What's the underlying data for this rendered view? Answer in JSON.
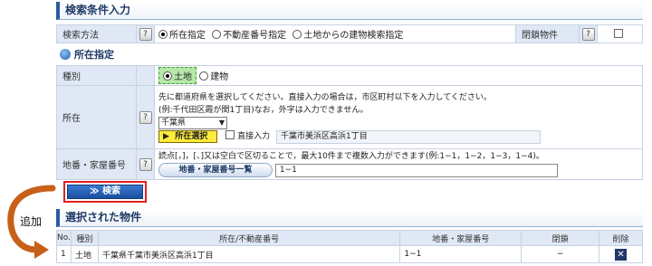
{
  "search_conditions": {
    "title": "検索条件入力",
    "method_label": "検索方法",
    "method_options": [
      "所在指定",
      "不動産番号指定",
      "土地からの建物検索指定"
    ],
    "closed_label": "閉鎖物件"
  },
  "location": {
    "title": "所在指定",
    "type_label": "種別",
    "type_options": [
      "土地",
      "建物"
    ],
    "address_label": "所在",
    "help_line1": "先に都道府県を選択してください。直接入力の場合は，市区町村以下を入力してください。",
    "help_line2": "(例:千代田区霞が関1丁目)なお，外字は入力できません。",
    "prefecture_value": "千葉県",
    "select_button": "所在選択",
    "direct_input_label": "直接入力",
    "address_value": "千葉市美浜区高浜1丁目",
    "lot_label": "地番・家屋番号",
    "lot_help": "読点[，]，[、]又は空白で区切ることで，最大10件まで複数入力ができます(例:1−1，1−2，1−3，1−4)。",
    "lot_list_button": "地番・家屋番号一覧",
    "lot_value": "1−1"
  },
  "search_button": "≫ 検索",
  "add_label": "追加",
  "results": {
    "title": "選択された物件",
    "headers": [
      "No.",
      "種別",
      "所在/不動産番号",
      "地番・家屋番号",
      "閉鎖",
      "削除"
    ],
    "rows": [
      {
        "no": "1",
        "type": "土地",
        "location": "千葉県千葉市美浜区高浜1丁目",
        "lot": "1−1",
        "closed": "−"
      }
    ]
  },
  "help_icon": "?",
  "colors": {
    "accent": "#2b5aa0",
    "highlight_border": "#e02020",
    "yellow": "#ffeb3b",
    "arrow": "#c8601a"
  }
}
